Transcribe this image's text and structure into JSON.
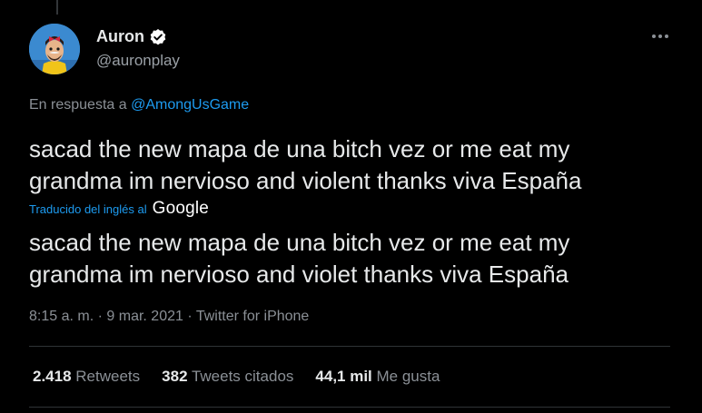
{
  "author": {
    "name": "Auron",
    "handle": "@auronplay",
    "verified": true
  },
  "reply": {
    "prefix": "En respuesta a",
    "mention": "@AmongUsGame"
  },
  "tweet": {
    "original_text": "sacad the new mapa de una bitch vez or me eat my\ngrandma im nervioso and violent thanks viva España",
    "translated_by_label": "Traducido del inglés al",
    "translator_name": "Google",
    "translated_text": "sacad the new mapa de una bitch vez or me eat my\ngrandma im nervioso and violet thanks viva España"
  },
  "meta": {
    "time": "8:15 a. m.",
    "separator": "·",
    "date": "9 mar. 2021",
    "source": "Twitter for iPhone"
  },
  "stats": {
    "retweets_count": "2.418",
    "retweets_label": "Retweets",
    "quotes_count": "382",
    "quotes_label": "Tweets citados",
    "likes_count": "44,1 mil",
    "likes_label": "Me gusta"
  },
  "colors": {
    "background": "#000000",
    "link": "#1d9bf0",
    "text": "#e7e9ea",
    "muted": "#8b9096"
  },
  "icons": {
    "verified": "verified-badge-icon",
    "more": "more-options-icon"
  }
}
